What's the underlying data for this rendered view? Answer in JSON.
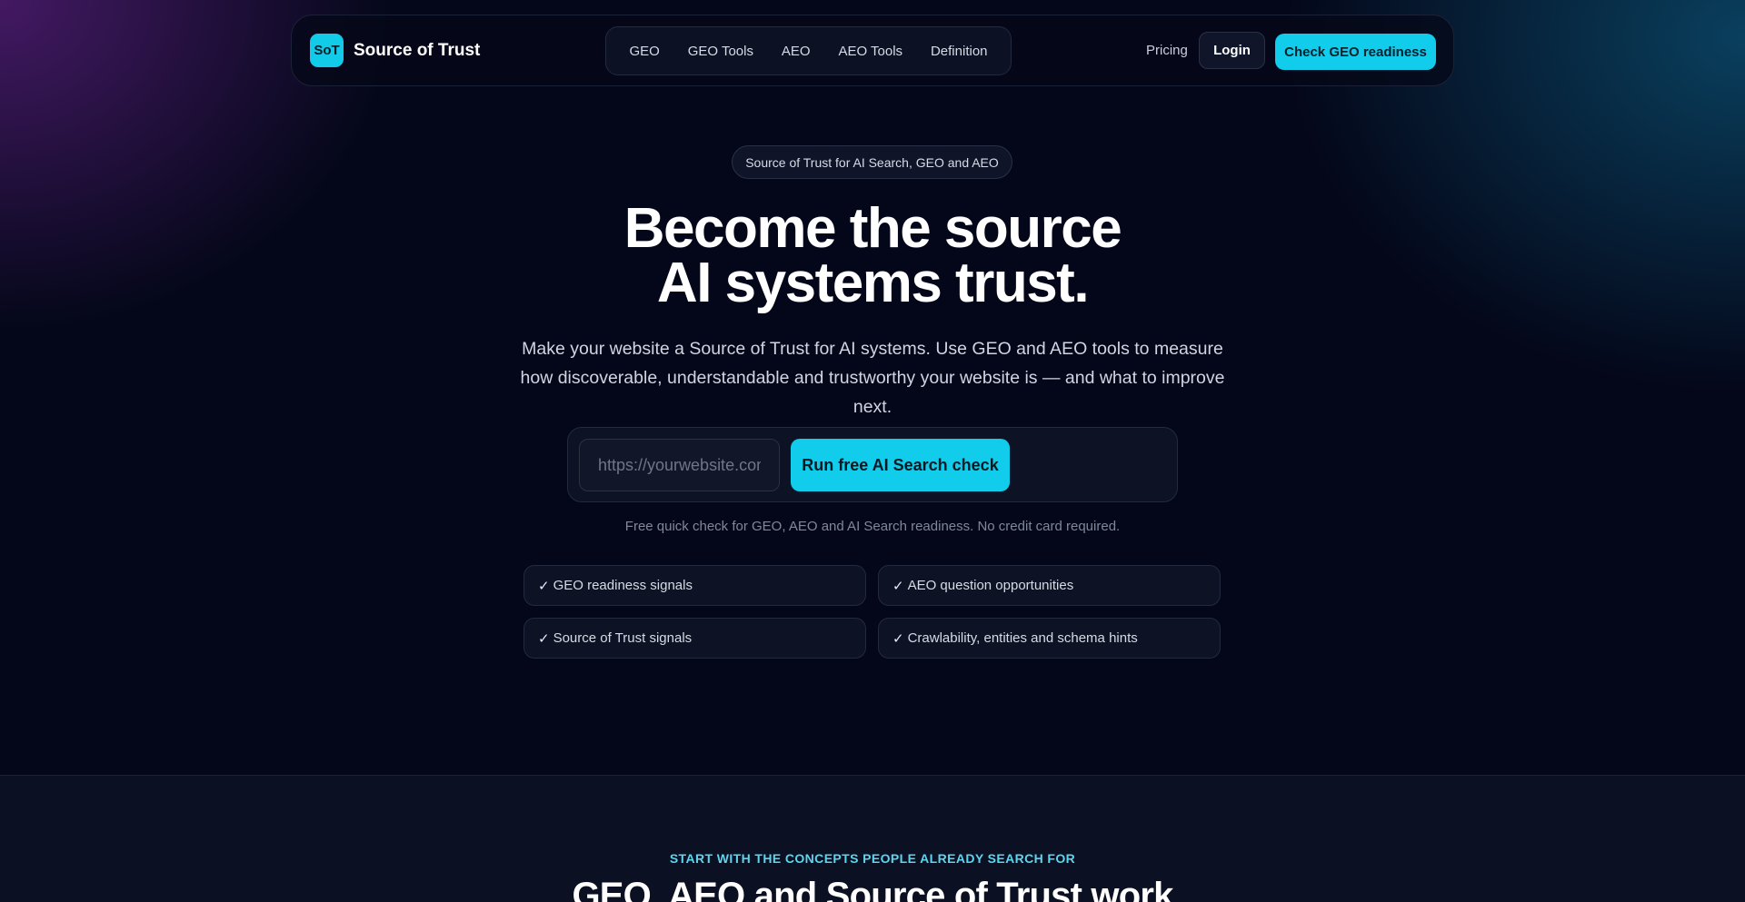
{
  "brand": {
    "badge": "SoT",
    "name": "Source of Trust",
    "accent": "#12cceb"
  },
  "nav": {
    "links": [
      "GEO",
      "GEO Tools",
      "AEO",
      "AEO Tools",
      "Definition"
    ],
    "pricing": "Pricing",
    "login": "Login",
    "cta": "Check GEO readiness"
  },
  "hero": {
    "eyebrow": "Source of Trust for AI Search, GEO and AEO",
    "headline_line1": "Become the source",
    "headline_line2": "AI systems trust.",
    "subline": "Make your website a Source of Trust for AI systems. Use GEO and AEO tools to measure how discoverable, understandable and trustworthy your website is — and what to improve next.",
    "url_placeholder": "https://yourwebsite.com",
    "run_button": "Run free AI Search check",
    "fine_print": "Free quick check for GEO, AEO and AI Search readiness. No credit card required.",
    "check_mark": "✓",
    "features": [
      "GEO readiness signals",
      "AEO question opportunities",
      "Source of Trust signals",
      "Crawlability, entities and schema hints"
    ]
  },
  "section": {
    "eyebrow": "START WITH THE CONCEPTS PEOPLE ALREADY SEARCH FOR",
    "title": "GEO, AEO and Source of Trust work"
  }
}
